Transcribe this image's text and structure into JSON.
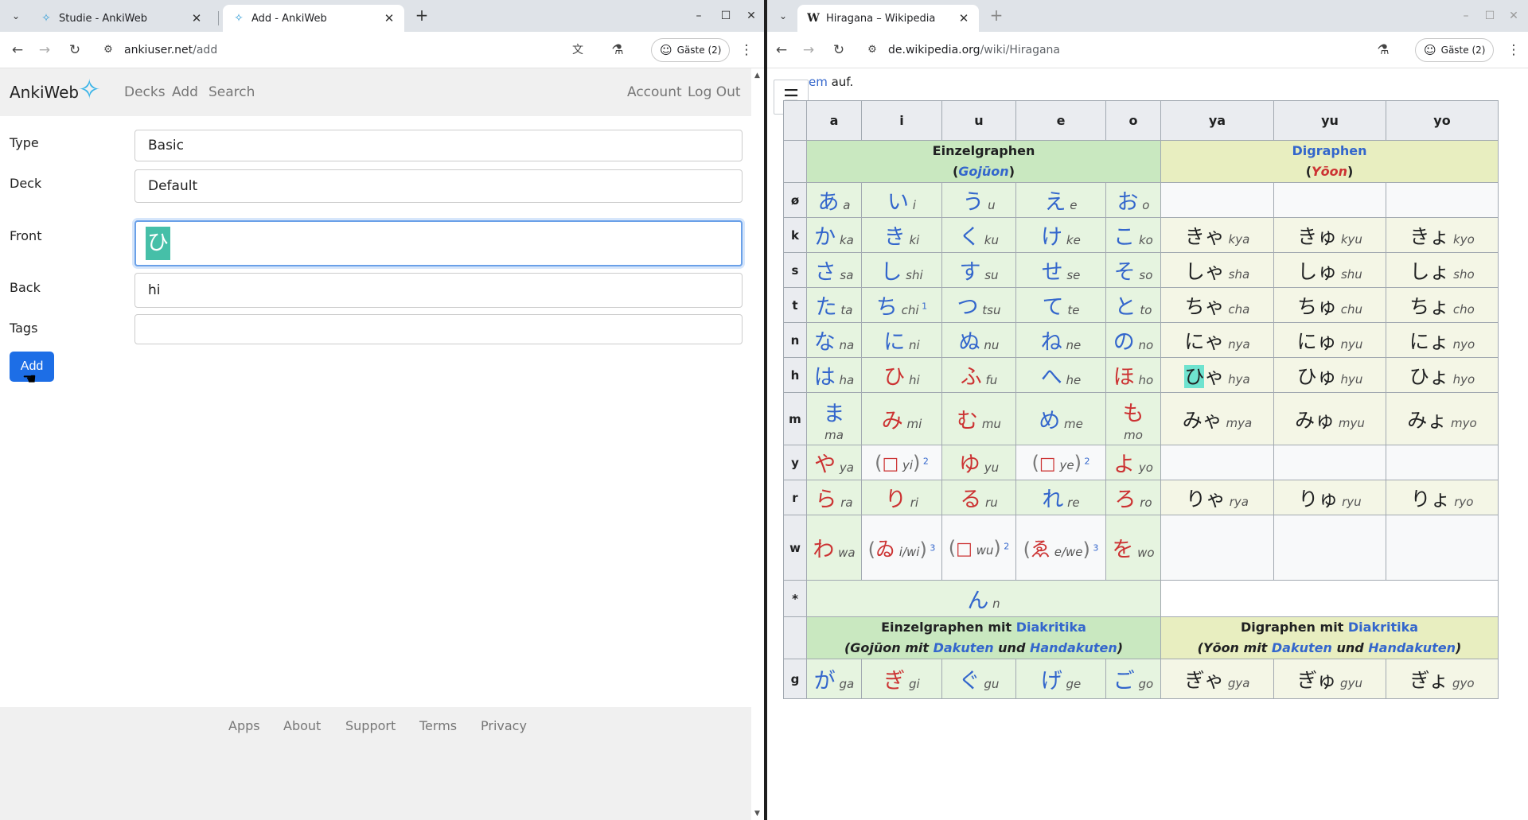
{
  "left": {
    "tabs": [
      {
        "title": "Studie - AnkiWeb"
      },
      {
        "title": "Add - AnkiWeb"
      }
    ],
    "url_host": "ankiuser.net",
    "url_path": "/add",
    "profile": "Gäste (2)",
    "anki": {
      "brand": "AnkiWeb",
      "nav_left": [
        "Decks",
        "Add",
        "Search"
      ],
      "nav_right": [
        "Account",
        "Log Out"
      ],
      "fields": {
        "type_label": "Type",
        "type_value": "Basic",
        "deck_label": "Deck",
        "deck_value": "Default",
        "front_label": "Front",
        "front_value": "ひ",
        "back_label": "Back",
        "back_value": "hi",
        "tags_label": "Tags",
        "tags_value": ""
      },
      "add_button": "Add",
      "footer": [
        "Apps",
        "About",
        "Support",
        "Terms",
        "Privacy"
      ]
    }
  },
  "right": {
    "tab": {
      "title": "Hiragana – Wikipedia"
    },
    "url_host": "de.wikipedia.org",
    "url_path": "/wiki/Hiragana",
    "profile": "Gäste (2)",
    "top_line": {
      "link": "em",
      "text": " auf."
    },
    "columns": [
      "a",
      "i",
      "u",
      "e",
      "o",
      "ya",
      "yu",
      "yo"
    ],
    "group1": {
      "title": "Einzelgraphen",
      "sub": "Gojūon"
    },
    "group2": {
      "title": "Digraphen",
      "sub": "Yōon"
    },
    "rows": [
      {
        "label": "ø",
        "cells": [
          [
            "あ",
            "a",
            "b"
          ],
          [
            "い",
            "i",
            "b"
          ],
          [
            "う",
            "u",
            "b"
          ],
          [
            "え",
            "e",
            "b"
          ],
          [
            "お",
            "o",
            "b"
          ]
        ],
        "di": []
      },
      {
        "label": "k",
        "cells": [
          [
            "か",
            "ka",
            "b"
          ],
          [
            "き",
            "ki",
            "b"
          ],
          [
            "く",
            "ku",
            "b"
          ],
          [
            "け",
            "ke",
            "b"
          ],
          [
            "こ",
            "ko",
            "b"
          ]
        ],
        "di": [
          [
            "きゃ",
            "kya"
          ],
          [
            "きゅ",
            "kyu"
          ],
          [
            "きょ",
            "kyo"
          ]
        ]
      },
      {
        "label": "s",
        "cells": [
          [
            "さ",
            "sa",
            "b"
          ],
          [
            "し",
            "shi",
            "b"
          ],
          [
            "す",
            "su",
            "b"
          ],
          [
            "せ",
            "se",
            "b"
          ],
          [
            "そ",
            "so",
            "b"
          ]
        ],
        "di": [
          [
            "しゃ",
            "sha"
          ],
          [
            "しゅ",
            "shu"
          ],
          [
            "しょ",
            "sho"
          ]
        ]
      },
      {
        "label": "t",
        "cells": [
          [
            "た",
            "ta",
            "b"
          ],
          [
            "ち",
            "chi",
            "b"
          ],
          [
            "つ",
            "tsu",
            "b"
          ],
          [
            "て",
            "te",
            "b"
          ],
          [
            "と",
            "to",
            "b"
          ]
        ],
        "di": [
          [
            "ちゃ",
            "cha"
          ],
          [
            "ちゅ",
            "chu"
          ],
          [
            "ちょ",
            "cho"
          ]
        ]
      },
      {
        "label": "n",
        "cells": [
          [
            "な",
            "na",
            "b"
          ],
          [
            "に",
            "ni",
            "b"
          ],
          [
            "ぬ",
            "nu",
            "b"
          ],
          [
            "ね",
            "ne",
            "b"
          ],
          [
            "の",
            "no",
            "b"
          ]
        ],
        "di": [
          [
            "にゃ",
            "nya"
          ],
          [
            "にゅ",
            "nyu"
          ],
          [
            "にょ",
            "nyo"
          ]
        ]
      },
      {
        "label": "h",
        "cells": [
          [
            "は",
            "ha",
            "b"
          ],
          [
            "ひ",
            "hi",
            "r"
          ],
          [
            "ふ",
            "fu",
            "r"
          ],
          [
            "へ",
            "he",
            "b"
          ],
          [
            "ほ",
            "ho",
            "r"
          ]
        ],
        "di": [
          [
            "ひゃ",
            "hya"
          ],
          [
            "ひゅ",
            "hyu"
          ],
          [
            "ひょ",
            "hyo"
          ]
        ]
      },
      {
        "label": "m",
        "cells": [
          [
            "ま",
            "ma",
            "b"
          ],
          [
            "み",
            "mi",
            "r"
          ],
          [
            "む",
            "mu",
            "r"
          ],
          [
            "め",
            "me",
            "b"
          ],
          [
            "も",
            "mo",
            "r"
          ]
        ],
        "di": [
          [
            "みゃ",
            "mya"
          ],
          [
            "みゅ",
            "myu"
          ],
          [
            "みょ",
            "myo"
          ]
        ]
      },
      {
        "label": "y",
        "cells": [
          [
            "や",
            "ya",
            "r"
          ],
          [
            "□",
            "yi",
            "p"
          ],
          [
            "ゆ",
            "yu",
            "r"
          ],
          [
            "□",
            "ye",
            "p"
          ],
          [
            "よ",
            "yo",
            "r"
          ]
        ],
        "di": []
      },
      {
        "label": "r",
        "cells": [
          [
            "ら",
            "ra",
            "r"
          ],
          [
            "り",
            "ri",
            "r"
          ],
          [
            "る",
            "ru",
            "r"
          ],
          [
            "れ",
            "re",
            "b"
          ],
          [
            "ろ",
            "ro",
            "r"
          ]
        ],
        "di": [
          [
            "りゃ",
            "rya"
          ],
          [
            "りゅ",
            "ryu"
          ],
          [
            "りょ",
            "ryo"
          ]
        ]
      },
      {
        "label": "w",
        "cells": [
          [
            "わ",
            "wa",
            "r"
          ],
          [
            "ゐ",
            "i/wi",
            "p"
          ],
          [
            "□",
            "wu",
            "p"
          ],
          [
            "ゑ",
            "e/we",
            "p"
          ],
          [
            "を",
            "wo",
            "r"
          ]
        ],
        "di": []
      }
    ],
    "n_row": {
      "label": "*",
      "kana": "ん",
      "roma": "n"
    },
    "group3": {
      "title": "Einzelgraphen mit ",
      "link": "Diakritika",
      "sub1": "Gojūon mit ",
      "dakuten": "Dakuten",
      "und": " und ",
      "handakuten": "Handakuten"
    },
    "group4": {
      "title": "Digraphen mit ",
      "link": "Diakritika",
      "sub1": "Yōon mit ",
      "dakuten": "Dakuten",
      "und": " und ",
      "handakuten": "Handakuten"
    },
    "g_row": {
      "label": "g",
      "cells": [
        [
          "が",
          "ga",
          "b"
        ],
        [
          "ぎ",
          "gi",
          "r"
        ],
        [
          "ぐ",
          "gu",
          "b"
        ],
        [
          "げ",
          "ge",
          "b"
        ],
        [
          "ご",
          "go",
          "b"
        ]
      ],
      "di": [
        [
          "ぎゃ",
          "gya"
        ],
        [
          "ぎゅ",
          "gyu"
        ],
        [
          "ぎょ",
          "gyo"
        ]
      ]
    },
    "footnotes": {
      "chi": "1",
      "yi": "2",
      "ye": "2",
      "wi": "3",
      "wu": "2",
      "we": "3"
    }
  }
}
